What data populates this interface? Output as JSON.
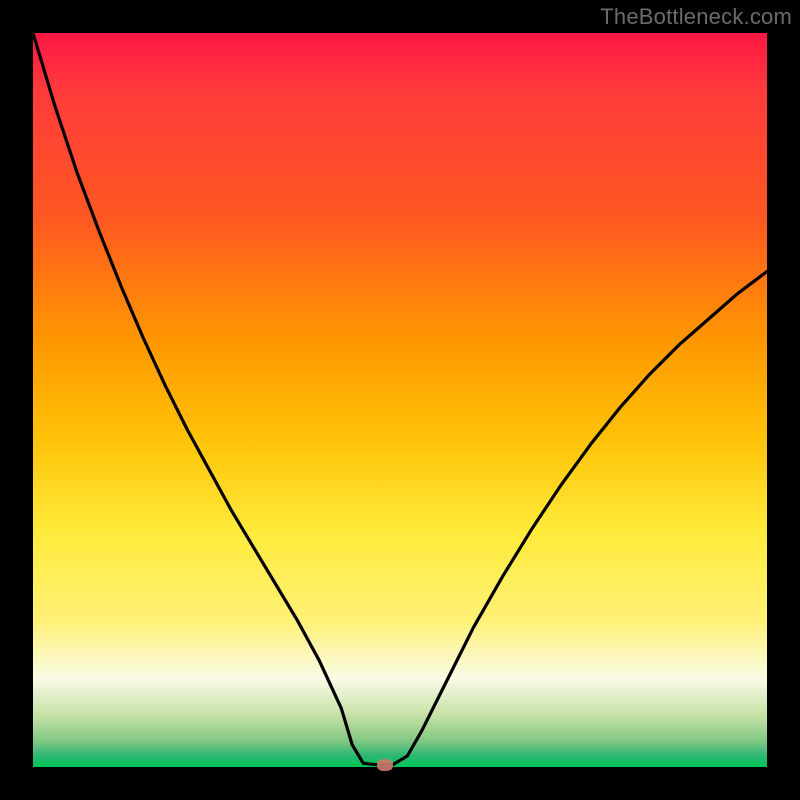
{
  "watermark": "TheBottleneck.com",
  "chart_data": {
    "type": "line",
    "title": "",
    "xlabel": "",
    "ylabel": "",
    "xlim": [
      0,
      100
    ],
    "ylim": [
      0,
      100
    ],
    "grid": false,
    "series": [
      {
        "name": "curve",
        "x": [
          0,
          3,
          6,
          9,
          12,
          15,
          18,
          21,
          24,
          27,
          30,
          33,
          36,
          39,
          42,
          43.5,
          45,
          47,
          49,
          51,
          53,
          56,
          60,
          64,
          68,
          72,
          76,
          80,
          84,
          88,
          92,
          96,
          100
        ],
        "y": [
          100,
          90,
          81,
          73,
          65.5,
          58.5,
          52,
          46,
          40.5,
          35,
          30,
          25,
          20,
          14.5,
          8,
          3,
          0.5,
          0.3,
          0.3,
          1.5,
          5,
          11,
          19,
          26,
          32.5,
          38.5,
          44,
          49,
          53.5,
          57.5,
          61,
          64.5,
          67.5
        ]
      }
    ],
    "marker": {
      "x": 48,
      "y": 0.3
    },
    "gradient_note": "background vertical gradient red→orange→yellow→green indicating high-to-low bottleneck"
  }
}
